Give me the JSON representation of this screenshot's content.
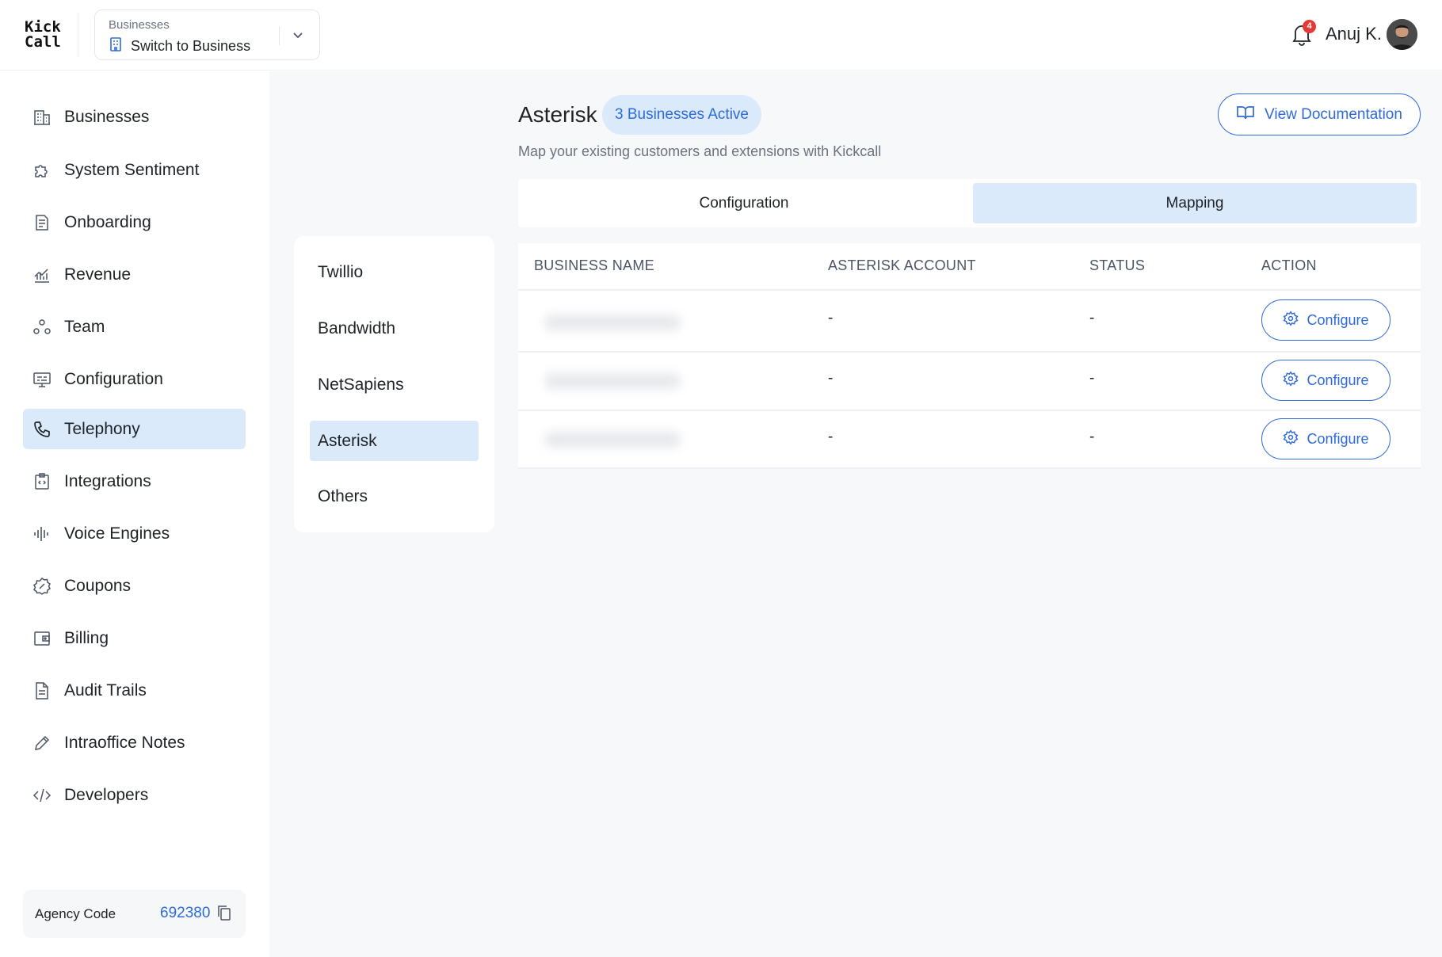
{
  "header": {
    "logo_line1": "Kick",
    "logo_line2": "Call",
    "business_switch": {
      "caption": "Businesses",
      "value": "Switch to Business"
    },
    "notifications_count": "4",
    "user_name": "Anuj K."
  },
  "sidebar": {
    "items": [
      {
        "label": "Businesses",
        "icon": "building-icon"
      },
      {
        "label": "System Sentiment",
        "icon": "puzzle-icon"
      },
      {
        "label": "Onboarding",
        "icon": "document-lines-icon"
      },
      {
        "label": "Revenue",
        "icon": "chart-icon"
      },
      {
        "label": "Team",
        "icon": "team-icon"
      },
      {
        "label": "Configuration",
        "icon": "monitor-settings-icon"
      },
      {
        "label": "Telephony",
        "icon": "phone-icon",
        "active": true
      },
      {
        "label": "Integrations",
        "icon": "code-clipboard-icon"
      },
      {
        "label": "Voice Engines",
        "icon": "waveform-icon"
      },
      {
        "label": "Coupons",
        "icon": "coupon-icon"
      },
      {
        "label": "Billing",
        "icon": "wallet-icon"
      },
      {
        "label": "Audit Trails",
        "icon": "file-icon"
      },
      {
        "label": "Intraoffice Notes",
        "icon": "pencil-icon"
      },
      {
        "label": "Developers",
        "icon": "code-icon"
      }
    ],
    "agency": {
      "label": "Agency Code",
      "code": "692380"
    }
  },
  "providers": {
    "items": [
      "Twillio",
      "Bandwidth",
      "NetSapiens",
      "Asterisk",
      "Others"
    ],
    "active": "Asterisk"
  },
  "main": {
    "title": "Asterisk",
    "active_badge": "3 Businesses Active",
    "subtitle": "Map your existing customers and extensions with Kickcall",
    "doc_button": "View Documentation",
    "tabs": [
      {
        "label": "Configuration",
        "active": false
      },
      {
        "label": "Mapping",
        "active": true
      }
    ],
    "table": {
      "columns": [
        "BUSINESS NAME",
        "ASTERISK ACCOUNT",
        "STATUS",
        "ACTION"
      ],
      "rows": [
        {
          "account": "-",
          "status": "-",
          "action": "Configure"
        },
        {
          "account": "-",
          "status": "-",
          "action": "Configure"
        },
        {
          "account": "-",
          "status": "-",
          "action": "Configure"
        }
      ]
    }
  },
  "colors": {
    "accent": "#2f6bd8",
    "active_bg": "#daeafb",
    "page_bg": "#f7f8fa",
    "badge_red": "#e53935"
  }
}
